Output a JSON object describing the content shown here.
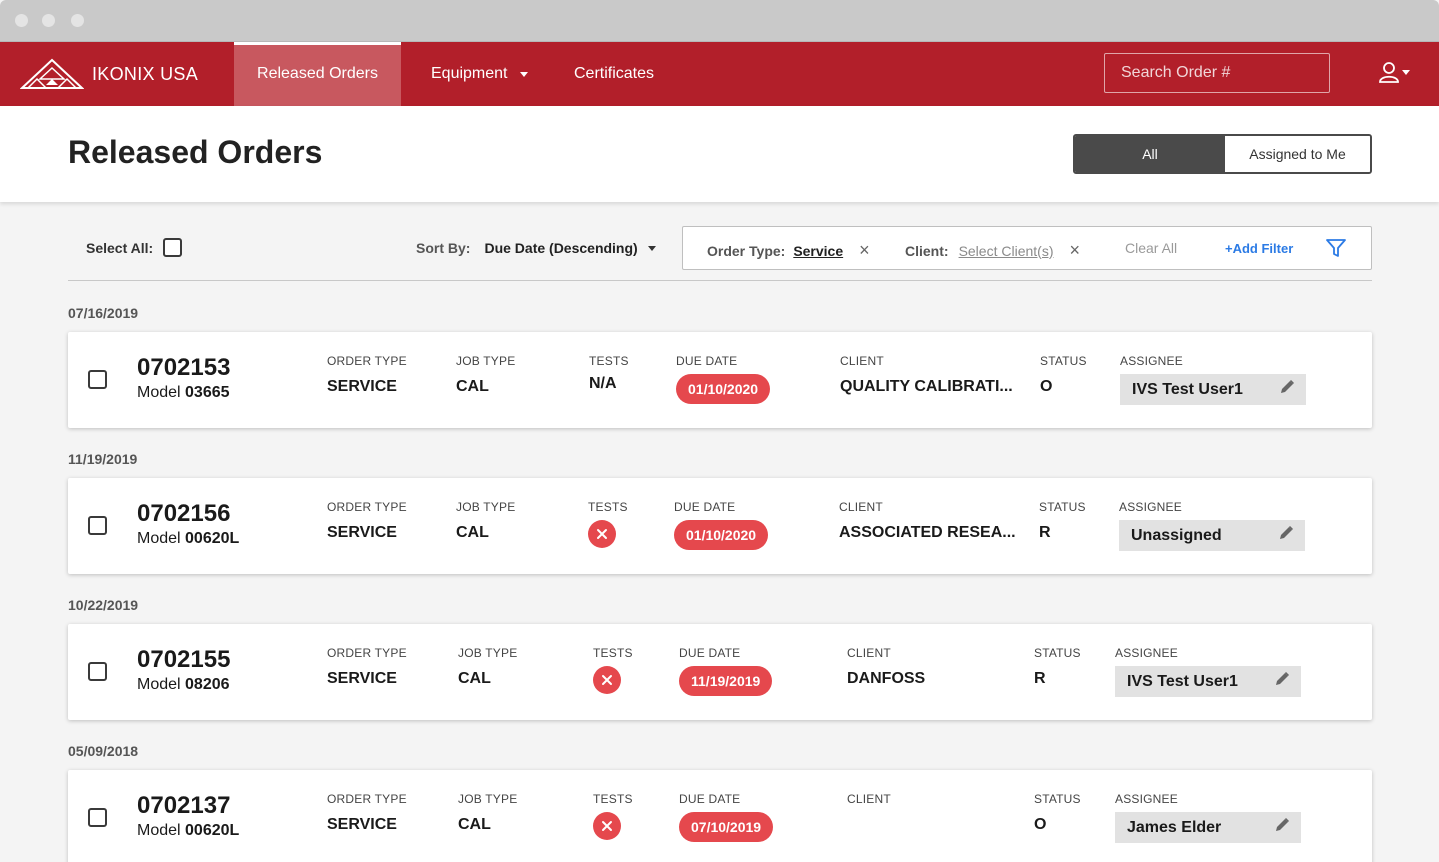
{
  "navbar": {
    "brand": "IKONIX USA",
    "tabs": [
      {
        "label": "Released Orders"
      },
      {
        "label": "Equipment"
      },
      {
        "label": "Certificates"
      }
    ],
    "search_placeholder": "Search Order #"
  },
  "page": {
    "title": "Released Orders",
    "toggle": [
      "All",
      "Assigned to Me"
    ]
  },
  "toolbar": {
    "select_all_label": "Select All:",
    "sort_label": "Sort By:",
    "sort_value": "Due Date (Descending)",
    "filters": [
      {
        "key": "Order Type:",
        "value": "Service"
      },
      {
        "key": "Client:",
        "value": "Select Client(s)"
      }
    ],
    "clear_all": "Clear All",
    "add_filter": "+Add Filter"
  },
  "columns": {
    "order_type": "ORDER TYPE",
    "job_type": "JOB TYPE",
    "tests": "TESTS",
    "due_date": "DUE DATE",
    "client": "CLIENT",
    "status": "STATUS",
    "assignee": "ASSIGNEE"
  },
  "model_prefix": "Model",
  "orders": [
    {
      "group_date": "07/16/2019",
      "order_no": "0702153",
      "model": "03665",
      "order_type": "SERVICE",
      "job_type": "CAL",
      "tests": "N/A",
      "due_date": "01/10/2020",
      "client": "QUALITY CALIBRATI...",
      "status": "O",
      "assignee": "IVS Test User1"
    },
    {
      "group_date": "11/19/2019",
      "order_no": "0702156",
      "model": "00620L",
      "order_type": "SERVICE",
      "job_type": "CAL",
      "tests": "",
      "due_date": "01/10/2020",
      "client": "ASSOCIATED RESEA...",
      "status": "R",
      "assignee": "Unassigned"
    },
    {
      "group_date": "10/22/2019",
      "order_no": "0702155",
      "model": "08206",
      "order_type": "SERVICE",
      "job_type": "CAL",
      "tests": "",
      "due_date": "11/19/2019",
      "client": "DANFOSS",
      "status": "R",
      "assignee": "IVS Test User1"
    },
    {
      "group_date": "05/09/2018",
      "order_no": "0702137",
      "model": "00620L",
      "order_type": "SERVICE",
      "job_type": "CAL",
      "tests": "",
      "due_date": "07/10/2019",
      "client": "",
      "status": "O",
      "assignee": "James Elder"
    }
  ],
  "colors": {
    "brand": "#b21f2a",
    "overdue": "#e5484d",
    "link": "#2c7be5"
  }
}
